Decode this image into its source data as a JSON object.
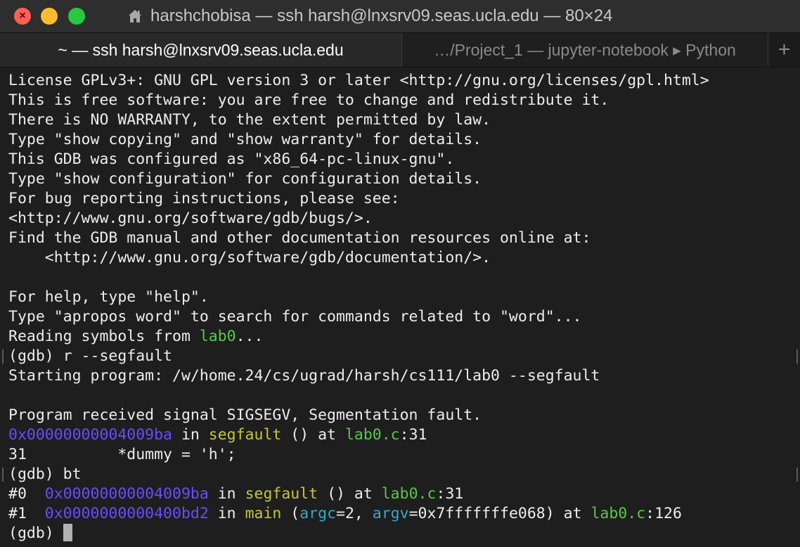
{
  "window": {
    "title": "harshchobisa — ssh harsh@lnxsrv09.seas.ucla.edu — 80×24",
    "close_glyph": "×"
  },
  "tabs": {
    "active": "~ — ssh harsh@lnxsrv09.seas.ucla.edu",
    "inactive": "…/Project_1 — jupyter-notebook ▸ Python",
    "add": "+"
  },
  "terminal": {
    "l1": "License GPLv3+: GNU GPL version 3 or later <http://gnu.org/licenses/gpl.html>",
    "l2": "This is free software: you are free to change and redistribute it.",
    "l3": "There is NO WARRANTY, to the extent permitted by law.",
    "l4": "Type \"show copying\" and \"show warranty\" for details.",
    "l5": "This GDB was configured as \"x86_64-pc-linux-gnu\".",
    "l6": "Type \"show configuration\" for configuration details.",
    "l7": "For bug reporting instructions, please see:",
    "l8": "<http://www.gnu.org/software/gdb/bugs/>.",
    "l9": "Find the GDB manual and other documentation resources online at:",
    "l10": "    <http://www.gnu.org/software/gdb/documentation/>.",
    "l12": "For help, type \"help\".",
    "l13": "Type \"apropos word\" to search for commands related to \"word\"...",
    "l14_pre": "Reading symbols from ",
    "l14_file": "lab0",
    "l14_post": "...",
    "l15": "(gdb) r --segfault",
    "l16": "Starting program: /w/home.24/cs/ugrad/harsh/cs111/lab0 --segfault",
    "l18": "Program received signal SIGSEGV, Segmentation fault.",
    "l19_addr": "0x00000000004009ba",
    "l19_in": " in ",
    "l19_func": "segfault",
    "l19_at": " () at ",
    "l19_file": "lab0.c",
    "l19_line": ":31",
    "l20": "31          *dummy = 'h';",
    "l21": "(gdb) bt",
    "l22_num": "#0  ",
    "l22_addr": "0x00000000004009ba",
    "l22_in": " in ",
    "l22_func": "segfault",
    "l22_at": " () at ",
    "l22_file": "lab0.c",
    "l22_line": ":31",
    "l23_num": "#1  ",
    "l23_addr": "0x0000000000400bd2",
    "l23_in": " in ",
    "l23_func": "main",
    "l23_open": " (",
    "l23_arg1": "argc",
    "l23_val1": "=2, ",
    "l23_arg2": "argv",
    "l23_val2": "=0x7fffffffe068) at ",
    "l23_file": "lab0.c",
    "l23_line": ":126",
    "prompt": "(gdb) "
  }
}
